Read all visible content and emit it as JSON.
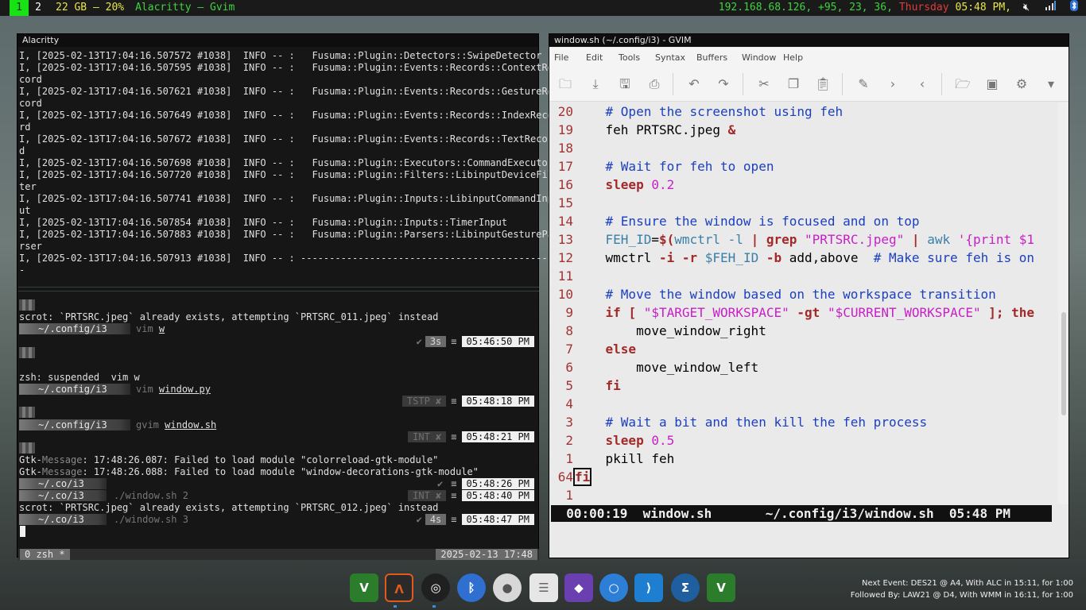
{
  "topbar": {
    "ws_active": "1",
    "ws_other": "2",
    "memory": "22 GB – 20%",
    "focused": "Alacritty – Gvim",
    "network": "192.168.68.126, +95, 23, 36,",
    "day": "Thursday",
    "time": "05:48 PM,",
    "icons": [
      "mute-icon",
      "signal-icon",
      "bluetooth-icon"
    ]
  },
  "alacritty": {
    "title": "Alacritty",
    "log_lines": [
      "I, [2025-02-13T17:04:16.507572 #1038]  INFO -- :   Fusuma::Plugin::Detectors::SwipeDetector",
      "I, [2025-02-13T17:04:16.507595 #1038]  INFO -- :   Fusuma::Plugin::Events::Records::ContextRe",
      "cord",
      "I, [2025-02-13T17:04:16.507621 #1038]  INFO -- :   Fusuma::Plugin::Events::Records::GestureRe",
      "cord",
      "I, [2025-02-13T17:04:16.507649 #1038]  INFO -- :   Fusuma::Plugin::Events::Records::IndexReco",
      "rd",
      "I, [2025-02-13T17:04:16.507672 #1038]  INFO -- :   Fusuma::Plugin::Events::Records::TextRecor",
      "d",
      "I, [2025-02-13T17:04:16.507698 #1038]  INFO -- :   Fusuma::Plugin::Executors::CommandExecutor",
      "I, [2025-02-13T17:04:16.507720 #1038]  INFO -- :   Fusuma::Plugin::Filters::LibinputDeviceFil",
      "ter",
      "I, [2025-02-13T17:04:16.507741 #1038]  INFO -- :   Fusuma::Plugin::Inputs::LibinputCommandInp",
      "ut",
      "I, [2025-02-13T17:04:16.507854 #1038]  INFO -- :   Fusuma::Plugin::Inputs::TimerInput",
      "I, [2025-02-13T17:04:16.507883 #1038]  INFO -- :   Fusuma::Plugin::Parsers::LibinputGesturePa",
      "rser",
      "I, [2025-02-13T17:04:16.507913 #1038]  INFO -- : ----------------------------------------------",
      "-"
    ],
    "scrot1": "scrot: `PRTSRC.jpeg` already exists, attempting `PRTSRC_011.jpeg` instead",
    "p1_dir": "~/.config/i3",
    "p1_cmd": "vim",
    "p1_arg": "w",
    "p1_check": "✔",
    "p1_dur": "3s",
    "p1_time": "05:46:50 PM",
    "suspended": "zsh: suspended  vim w",
    "p2_dir": "~/.config/i3",
    "p2_cmd": "vim",
    "p2_arg": "window.py",
    "p2_sig": "TSTP ✘",
    "p2_time": "05:48:18 PM",
    "p3_dir": "~/.config/i3",
    "p3_cmd": "gvim",
    "p3_arg": "window.sh",
    "p3_sig": "INT ✘",
    "p3_time": "05:48:21 PM",
    "gtk1_a": "Gtk-",
    "gtk1_b": "Message",
    "gtk1_c": ": 17:48:26.087: Failed to load module \"colorreload-gtk-module\"",
    "gtk2_a": "Gtk-",
    "gtk2_b": "Message",
    "gtk2_c": ": 17:48:26.088: Failed to load module \"window-decorations-gtk-module\"",
    "p4_dir": "~/.co/i3",
    "p4_time": "05:48:26 PM",
    "p5_dir": "~/.co/i3",
    "p5_cmd": "./window.sh 2",
    "p5_sig": "INT ✘",
    "p5_time": "05:48:40 PM",
    "scrot2": "scrot: `PRTSRC.jpeg` already exists, attempting `PRTSRC_012.jpeg` instead",
    "p6_dir": "~/.co/i3",
    "p6_cmd": "./window.sh 3",
    "p6_dur": "4s",
    "p6_time": "05:48:47 PM",
    "eq": "≡",
    "tmux_window": "0 zsh *",
    "tmux_date": "2025-02-13 17:48"
  },
  "gvim": {
    "title": "window.sh (~/.config/i3) - GVIM",
    "menu": [
      "File",
      "Edit",
      "Tools",
      "Syntax",
      "Buffers",
      "Window",
      "Help"
    ],
    "code": [
      {
        "n": "20",
        "parts": [
          [
            "",
            "    "
          ],
          [
            "cm",
            "# Open the screenshot using feh"
          ]
        ]
      },
      {
        "n": "19",
        "parts": [
          [
            "",
            "    feh PRTSRC.jpeg "
          ],
          [
            "kw",
            "&"
          ]
        ]
      },
      {
        "n": "18",
        "parts": []
      },
      {
        "n": "17",
        "parts": [
          [
            "",
            "    "
          ],
          [
            "cm",
            "# Wait for feh to open"
          ]
        ]
      },
      {
        "n": "16",
        "parts": [
          [
            "",
            "    "
          ],
          [
            "kw",
            "sleep"
          ],
          [
            "",
            " "
          ],
          [
            "nm",
            "0.2"
          ]
        ]
      },
      {
        "n": "15",
        "parts": []
      },
      {
        "n": "14",
        "parts": [
          [
            "",
            "    "
          ],
          [
            "cm",
            "# Ensure the window is focused and on top"
          ]
        ]
      },
      {
        "n": "13",
        "parts": [
          [
            "",
            "    "
          ],
          [
            "vr",
            "FEH_ID"
          ],
          [
            "",
            "="
          ],
          [
            "kw",
            "$("
          ],
          [
            "vr",
            "wmctrl -l"
          ],
          [
            "",
            " "
          ],
          [
            "kw",
            "|"
          ],
          [
            "",
            " "
          ],
          [
            "kw",
            "grep"
          ],
          [
            "",
            " "
          ],
          [
            "st",
            "\"PRTSRC.jpeg\""
          ],
          [
            "",
            " "
          ],
          [
            "kw",
            "|"
          ],
          [
            "",
            " "
          ],
          [
            "vr",
            "awk"
          ],
          [
            "",
            " "
          ],
          [
            "st",
            "'{print $1"
          ]
        ]
      },
      {
        "n": "12",
        "parts": [
          [
            "",
            "    wmctrl "
          ],
          [
            "kw",
            "-i -r"
          ],
          [
            "",
            " "
          ],
          [
            "vr",
            "$FEH_ID"
          ],
          [
            "",
            " "
          ],
          [
            "kw",
            "-b"
          ],
          [
            "",
            " add,above  "
          ],
          [
            "cm",
            "# Make sure feh is on"
          ]
        ]
      },
      {
        "n": "11",
        "parts": []
      },
      {
        "n": "10",
        "parts": [
          [
            "",
            "    "
          ],
          [
            "cm",
            "# Move the window based on the workspace transition"
          ]
        ]
      },
      {
        "n": "9",
        "parts": [
          [
            "",
            "    "
          ],
          [
            "kw",
            "if"
          ],
          [
            "",
            " "
          ],
          [
            "kw",
            "["
          ],
          [
            "",
            " "
          ],
          [
            "st",
            "\"$TARGET_WORKSPACE\""
          ],
          [
            "",
            " "
          ],
          [
            "kw",
            "-gt"
          ],
          [
            "",
            " "
          ],
          [
            "st",
            "\"$CURRENT_WORKSPACE\""
          ],
          [
            "",
            " "
          ],
          [
            "kw",
            "]; the"
          ]
        ]
      },
      {
        "n": "8",
        "parts": [
          [
            "",
            "        move_window_right"
          ]
        ]
      },
      {
        "n": "7",
        "parts": [
          [
            "",
            "    "
          ],
          [
            "kw",
            "else"
          ]
        ]
      },
      {
        "n": "6",
        "parts": [
          [
            "",
            "        move_window_left"
          ]
        ]
      },
      {
        "n": "5",
        "parts": [
          [
            "",
            "    "
          ],
          [
            "kw",
            "fi"
          ]
        ]
      },
      {
        "n": "4",
        "parts": []
      },
      {
        "n": "3",
        "parts": [
          [
            "",
            "    "
          ],
          [
            "cm",
            "# Wait a bit and then kill the feh process"
          ]
        ]
      },
      {
        "n": "2",
        "parts": [
          [
            "",
            "    "
          ],
          [
            "kw",
            "sleep"
          ],
          [
            "",
            " "
          ],
          [
            "nm",
            "0.5"
          ]
        ]
      },
      {
        "n": "1",
        "parts": [
          [
            "",
            "    pkill feh"
          ]
        ]
      },
      {
        "n": "64",
        "parts": [
          [
            "fl",
            "fi"
          ]
        ]
      },
      {
        "n": "1",
        "parts": []
      }
    ],
    "status": "  00:00:19  window.sh       ~/.config/i3/window.sh  05:48 PM"
  },
  "dock": {
    "apps": [
      "vim-icon",
      "alacritty-icon",
      "obs-icon",
      "bluetooth-icon",
      "mouse-icon",
      "files-icon",
      "crystal-icon",
      "chromium-icon",
      "vscode-icon",
      "speed-icon",
      "vim-icon"
    ]
  },
  "events": {
    "next": "Next Event: DES21 @ A4, With ALC in 15:11, for 1:00",
    "followed": "Followed By: LAW21 @ D4, With WMM in 16:11, for 1:00"
  }
}
